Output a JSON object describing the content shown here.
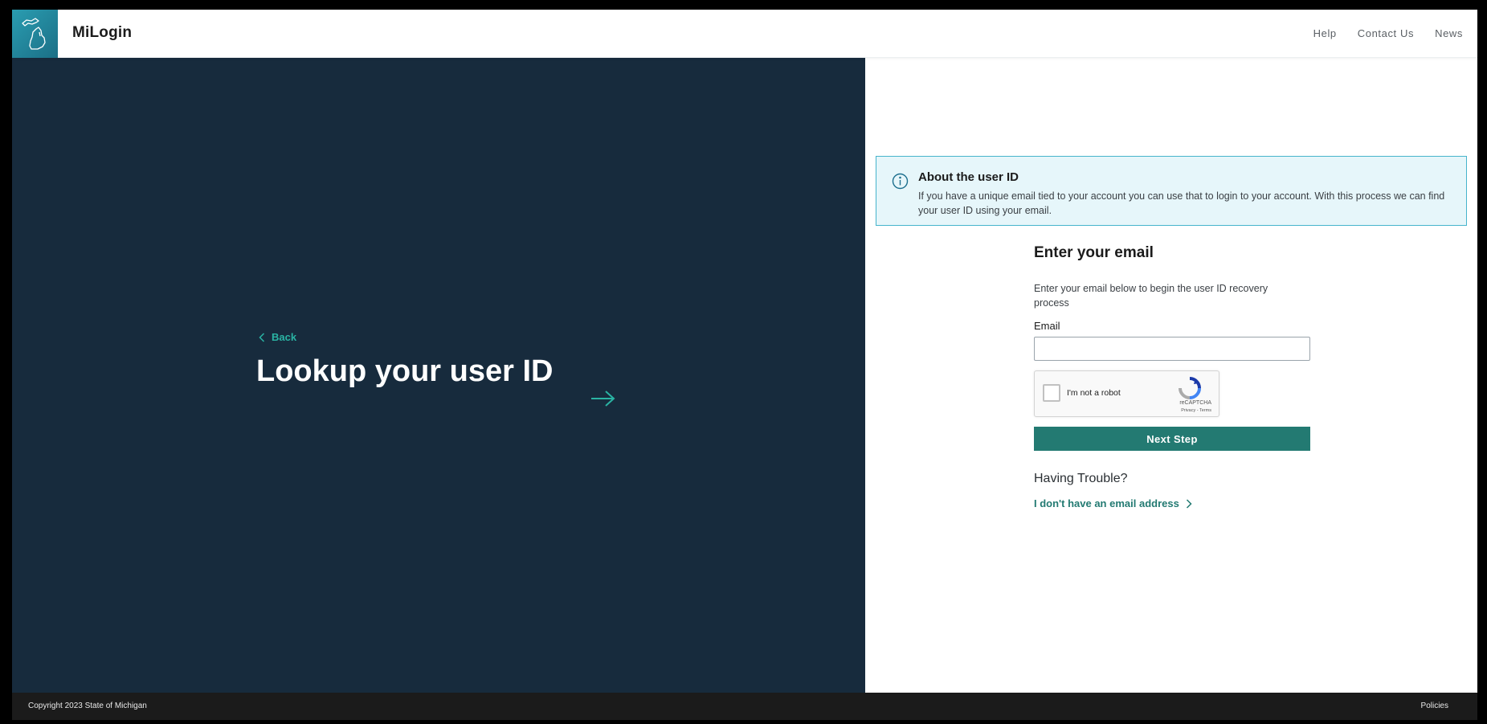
{
  "header": {
    "brand": "MiLogin",
    "nav": [
      "Help",
      "Contact Us",
      "News"
    ]
  },
  "left": {
    "back_label": "Back",
    "title": "Lookup your user ID"
  },
  "info": {
    "title": "About the user ID",
    "text": "If you have a unique email tied to your account you can use that to login to your account. With this process we can find your user ID using your email."
  },
  "form": {
    "title": "Enter your email",
    "description": "Enter your email below to begin the user ID recovery process",
    "email_label": "Email",
    "email_value": "",
    "captcha_label": "I'm not a robot",
    "captcha_brand": "reCAPTCHA",
    "captcha_links": "Privacy - Terms",
    "next_label": "Next Step",
    "trouble_title": "Having Trouble?",
    "no_email_link": "I don't have an email address"
  },
  "footer": {
    "copyright": "Copyright 2023 State of Michigan",
    "policies": "Policies"
  },
  "colors": {
    "left_panel": "#172b3d",
    "accent": "#237a72",
    "teal_link": "#2ab3a3",
    "info_bg": "#e6f6fa",
    "info_border": "#47b4cc",
    "footer": "#1b1b1b"
  },
  "icons": [
    "michigan-logo-icon",
    "chevron-left-icon",
    "arrow-right-icon",
    "info-icon",
    "recaptcha-icon",
    "chevron-right-icon"
  ]
}
